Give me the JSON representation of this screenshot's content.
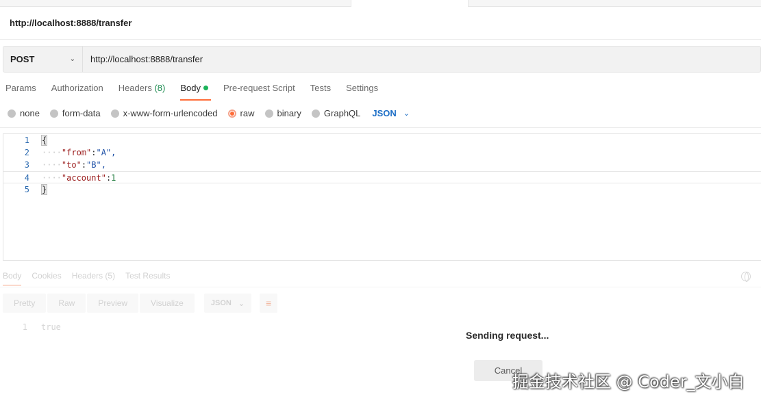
{
  "request": {
    "name": "http://localhost:8888/transfer",
    "method": "POST",
    "url": "http://localhost:8888/transfer"
  },
  "request_tabs": [
    {
      "label": "Params"
    },
    {
      "label": "Authorization"
    },
    {
      "label": "Headers",
      "count": "(8)"
    },
    {
      "label": "Body",
      "active": true
    },
    {
      "label": "Pre-request Script"
    },
    {
      "label": "Tests"
    },
    {
      "label": "Settings"
    }
  ],
  "body_types": {
    "none": "none",
    "form_data": "form-data",
    "urlencoded": "x-www-form-urlencoded",
    "raw": "raw",
    "binary": "binary",
    "graphql": "GraphQL",
    "selected": "raw",
    "language": "JSON"
  },
  "editor": {
    "line_numbers": [
      "1",
      "2",
      "3",
      "4",
      "5"
    ],
    "lines": [
      {
        "text": "{"
      },
      {
        "key": "\"from\"",
        "value": "\"A\","
      },
      {
        "key": "\"to\"",
        "value": "\"B\","
      },
      {
        "key": "\"account\"",
        "value": "1"
      },
      {
        "text": "}"
      }
    ]
  },
  "response": {
    "tabs": [
      "Body",
      "Cookies",
      "Headers",
      "(5)",
      "Test Results"
    ],
    "view_modes": [
      "Pretty",
      "Raw",
      "Preview",
      "Visualize"
    ],
    "format": "JSON",
    "line_number": "1",
    "line_value": "true"
  },
  "overlay": {
    "status": "Sending request...",
    "cancel_label": "Cancel"
  },
  "watermark": "掘金技术社区 @ Coder_文小白",
  "colors": {
    "accent": "#ff6c37",
    "link_blue": "#1c6ec6",
    "green_dot": "#1bb35a"
  }
}
